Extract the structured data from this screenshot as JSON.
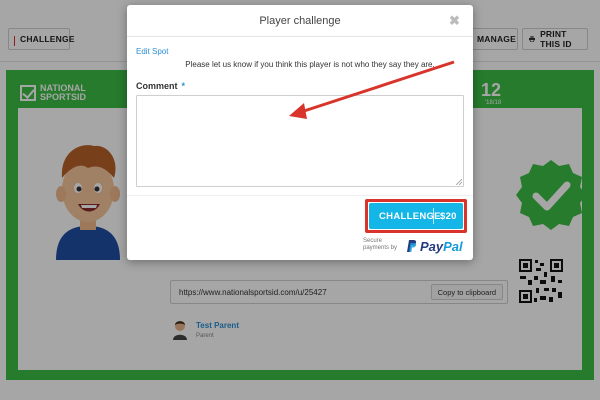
{
  "toolbar": {
    "challenge_label": "CHALLENGE",
    "manage_label": "MANAGE",
    "print_label": "PRINT THIS ID"
  },
  "card": {
    "brand_line1": "NATIONAL",
    "brand_line2": "SPORTSID",
    "id_partial": "12",
    "id_date": "'18/18",
    "profile_url": "https://www.nationalsportsid.com/u/25427",
    "copy_label": "Copy to clipboard",
    "parent_name": "Test Parent",
    "parent_role": "Parent"
  },
  "modal": {
    "title": "Player challenge",
    "close_glyph": "✖",
    "edit_link": "Edit Spot",
    "description": "Please let us know if you think this player is not who they say they are.",
    "comment_label": "Comment",
    "required_mark": "*",
    "comment_value": "",
    "pay_button_label": "CHALLENGE",
    "pay_button_price": "$20",
    "secure_line1": "Secure",
    "secure_line2": "payments by",
    "paypal_part1": "Pay",
    "paypal_part2": "Pal"
  },
  "colors": {
    "card_green": "#3cbd45",
    "pay_button": "#14b6e8",
    "highlight_red": "#d9342b",
    "link_blue": "#2a8fd6"
  },
  "icons": {
    "flag": "flag-icon",
    "print": "printer-icon",
    "caret": "caret-down-icon",
    "verified": "checkmark-badge-icon",
    "qr": "qr-code-icon",
    "paypal": "paypal-logo-icon",
    "arrow": "red-arrow-annotation"
  }
}
